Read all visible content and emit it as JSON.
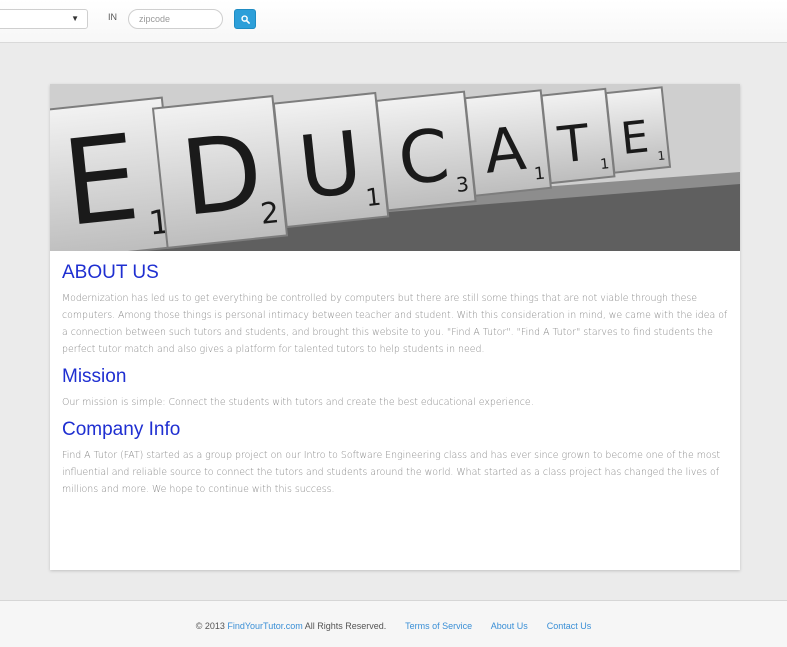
{
  "topbar": {
    "in_label": "IN",
    "zip_placeholder": "zipcode",
    "select_value": ""
  },
  "hero": {
    "tiles": [
      {
        "letter": "E",
        "score": "1"
      },
      {
        "letter": "D",
        "score": "2"
      },
      {
        "letter": "U",
        "score": "1"
      },
      {
        "letter": "C",
        "score": "3"
      },
      {
        "letter": "A",
        "score": "1"
      },
      {
        "letter": "T",
        "score": "1"
      },
      {
        "letter": "E",
        "score": "1"
      }
    ]
  },
  "about": {
    "title": "ABOUT US",
    "body": "Modernization has led us to get everything be controlled by computers but there are still some things that are not viable through these computers. Among those things is personal intimacy between teacher and student. With this consideration in mind, we came with the idea of a connection between such tutors and students, and brought this website to you. \"Find A Tutor\". \"Find A Tutor\" starves to find students the perfect tutor match and also gives a platform for talented tutors to help students in need."
  },
  "mission": {
    "title": "Mission",
    "body": "Our mission is simple: Connect the students with tutors and create the best educational experience."
  },
  "company": {
    "title": "Company Info",
    "body": "Find A Tutor (FAT) started as a group project on our Intro to Software Engineering class and has ever since grown to become one of the most influential and reliable source to connect the tutors and students around the world. What started as a class project has changed the lives of millions and more. We hope to continue with this success."
  },
  "footer": {
    "copyright": "© 2013",
    "site_link": "FindYourTutor.com",
    "rights": "All Rights Reserved.",
    "terms": "Terms of Service",
    "about": "About Us",
    "contact": "Contact Us"
  }
}
